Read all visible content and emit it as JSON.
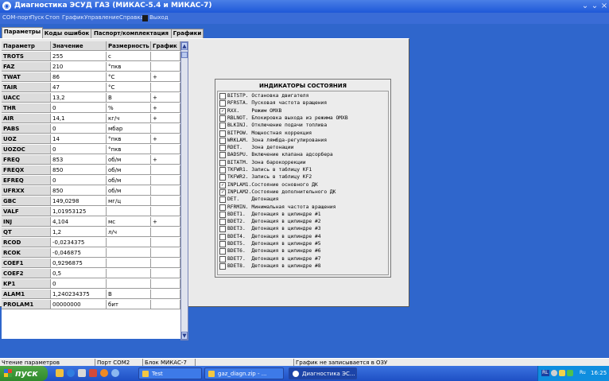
{
  "window": {
    "title": "Диагностика ЭСУД ГАЗ (МИКАС-5.4 и МИКАС-7)"
  },
  "menu": [
    "COM-порт",
    "Пуск",
    "Стоп",
    "График",
    "Управление",
    "Справка",
    "Выход"
  ],
  "tabs": [
    "Параметры",
    "Коды ошибок",
    "Паспорт/комплектация",
    "Графики"
  ],
  "grid": {
    "headers": [
      "Параметр",
      "Значение",
      "Размерность",
      "График"
    ],
    "rows": [
      {
        "name": "TROTS",
        "value": "255",
        "unit": "с",
        "graph": ""
      },
      {
        "name": "FAZ",
        "value": "210",
        "unit": "°пкв",
        "graph": ""
      },
      {
        "name": "TWAT",
        "value": "86",
        "unit": "°C",
        "graph": "+"
      },
      {
        "name": "TAIR",
        "value": "47",
        "unit": "°C",
        "graph": ""
      },
      {
        "name": "UACC",
        "value": "13,2",
        "unit": "В",
        "graph": "+"
      },
      {
        "name": "THR",
        "value": "0",
        "unit": "%",
        "graph": "+"
      },
      {
        "name": "AIR",
        "value": "14,1",
        "unit": "кг/ч",
        "graph": "+"
      },
      {
        "name": "PABS",
        "value": "0",
        "unit": "мбар",
        "graph": ""
      },
      {
        "name": "UOZ",
        "value": "14",
        "unit": "°пкв",
        "graph": "+"
      },
      {
        "name": "UOZOC",
        "value": "0",
        "unit": "°пкв",
        "graph": ""
      },
      {
        "name": "FREQ",
        "value": "853",
        "unit": "об/м",
        "graph": "+"
      },
      {
        "name": "FREQX",
        "value": "850",
        "unit": "об/м",
        "graph": ""
      },
      {
        "name": "EFREQ",
        "value": "0",
        "unit": "об/м",
        "graph": ""
      },
      {
        "name": "UFRXX",
        "value": "850",
        "unit": "об/м",
        "graph": ""
      },
      {
        "name": "GBC",
        "value": "149,0298",
        "unit": "мг/ц",
        "graph": ""
      },
      {
        "name": "VALF",
        "value": "1,01953125",
        "unit": "",
        "graph": ""
      },
      {
        "name": "INJ",
        "value": "4,104",
        "unit": "мс",
        "graph": "+"
      },
      {
        "name": "QT",
        "value": "1,2",
        "unit": "л/ч",
        "graph": ""
      },
      {
        "name": "RCOD",
        "value": "-0,0234375",
        "unit": "",
        "graph": ""
      },
      {
        "name": "RCOK",
        "value": "-0,046875",
        "unit": "",
        "graph": ""
      },
      {
        "name": "COEF1",
        "value": "0,9296875",
        "unit": "",
        "graph": ""
      },
      {
        "name": "COEF2",
        "value": "0,5",
        "unit": "",
        "graph": ""
      },
      {
        "name": "KP1",
        "value": "0",
        "unit": "",
        "graph": ""
      },
      {
        "name": "ALAM1",
        "value": "1,240234375",
        "unit": "В",
        "graph": ""
      },
      {
        "name": "PROLAM1",
        "value": "00000000",
        "unit": "бит",
        "graph": ""
      }
    ]
  },
  "scroll": {
    "up": "▲",
    "down": "▼"
  },
  "indicators": {
    "title": "ИНДИКАТОРЫ СОСТОЯНИЯ",
    "items": [
      {
        "label": "BITSTP. Остановка двигателя",
        "checked": false
      },
      {
        "label": "RFRSTA. Пусковая частота вращения",
        "checked": false
      },
      {
        "label": "RXX.    Режим ОМХВ",
        "checked": true
      },
      {
        "label": "RBLNOT. Блокировка выхода из режима ОМХВ",
        "checked": false
      },
      {
        "label": "BLKINJ. Отключение подачи топлива",
        "checked": false
      },
      {
        "label": "BITPOW. Мощностная коррекция",
        "checked": false
      },
      {
        "label": "WRKLAM. Зона лямбда-регулирования",
        "checked": false
      },
      {
        "label": "RDET.   Зона детонации",
        "checked": false
      },
      {
        "label": "BADSPU. Включение клапана адсорбера",
        "checked": false
      },
      {
        "label": "BITATM. Зона барокоррекции",
        "checked": false
      },
      {
        "label": "TKFWR1. Запись в таблицу KF1",
        "checked": false
      },
      {
        "label": "TKFWR2. Запись в таблицу KF2",
        "checked": false
      },
      {
        "label": "INPLAM1.Состояние основного ДК",
        "checked": true
      },
      {
        "label": "INPLAM2.Состояние дополнительного ДК",
        "checked": true
      },
      {
        "label": "DET.    Детонация",
        "checked": false
      },
      {
        "label": "RFRMIN. Минимальная частота вращения",
        "checked": false
      },
      {
        "label": "BDET1.  Детонация в цилиндре #1",
        "checked": false
      },
      {
        "label": "BDET2.  Детонация в цилиндре #2",
        "checked": false
      },
      {
        "label": "BDET3.  Детонация в цилиндре #3",
        "checked": false
      },
      {
        "label": "BDET4.  Детонация в цилиндре #4",
        "checked": false
      },
      {
        "label": "BDET5.  Детонация в цилиндре #5",
        "checked": false
      },
      {
        "label": "BDET6.  Детонация в цилиндре #6",
        "checked": false
      },
      {
        "label": "BDET7.  Детонация в цилиндре #7",
        "checked": false
      },
      {
        "label": "BDET8.  Детонация в цилиндре #8",
        "checked": false
      }
    ]
  },
  "status": [
    "Чтение параметров",
    "Порт COM2",
    "Блок МИКАС-7",
    "",
    "График не записывается в ОЗУ"
  ],
  "taskbar": {
    "start": "пуск",
    "buttons": [
      "Test",
      "gaz_diagn.zip - ...",
      "Диагностика ЭС..."
    ],
    "lang_badge": "RL",
    "lang": "Ru",
    "time": "16:25"
  }
}
